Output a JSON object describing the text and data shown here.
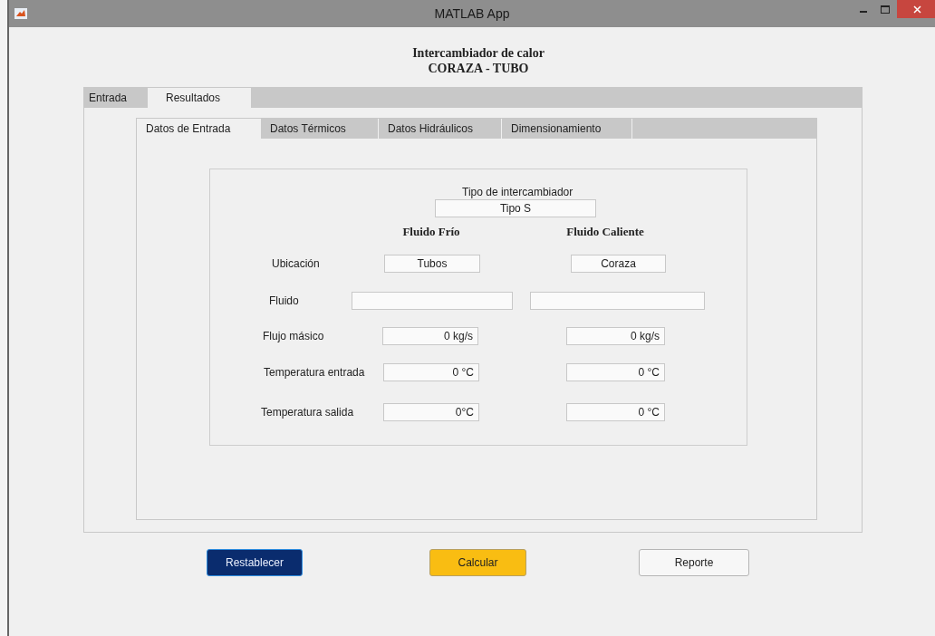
{
  "window": {
    "title": "MATLAB App"
  },
  "header": [
    "Intercambiador de calor",
    "CORAZA - TUBO"
  ],
  "tabs": [
    {
      "label": "Entrada",
      "selected": false
    },
    {
      "label": "Resultados",
      "selected": true
    }
  ],
  "subtabs": [
    {
      "label": "Datos de Entrada",
      "selected": true
    },
    {
      "label": "Datos Térmicos",
      "selected": false
    },
    {
      "label": "Datos Hidráulicos",
      "selected": false
    },
    {
      "label": "Dimensionamiento",
      "selected": false
    }
  ],
  "panel": {
    "type_label": "Tipo de intercambiador",
    "type_value": "Tipo S",
    "columns": [
      "Fluido Frío",
      "Fluido Caliente"
    ],
    "rows": [
      {
        "label": "Ubicación",
        "cold": "Tubos",
        "hot": "Coraza"
      },
      {
        "label": "Fluido"
      },
      {
        "label": "Flujo másico",
        "cold": "0 kg/s",
        "hot": "0 kg/s"
      },
      {
        "label": "Temperatura entrada",
        "cold": "0 °C",
        "hot": "0 °C"
      },
      {
        "label": "Temperatura salida",
        "cold": "0°C",
        "hot": "0 °C"
      }
    ]
  },
  "buttons": [
    {
      "label": "Restablecer",
      "kind": "primary"
    },
    {
      "label": "Calcular",
      "kind": "accent"
    },
    {
      "label": "Reporte",
      "kind": "default"
    }
  ]
}
